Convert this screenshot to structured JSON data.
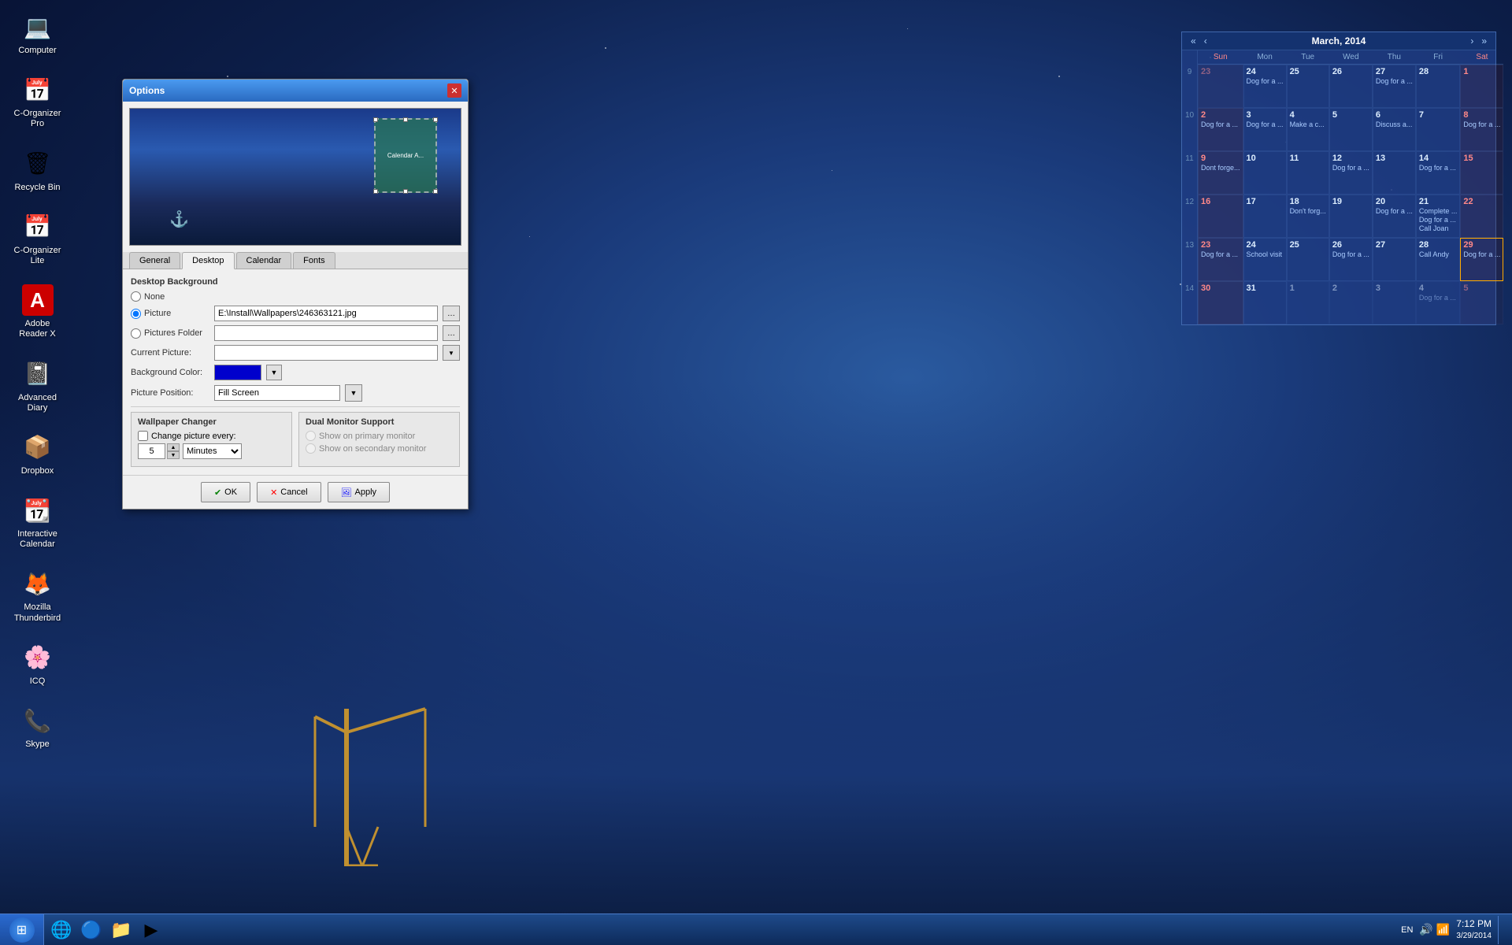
{
  "app": {
    "title": "Options"
  },
  "desktop": {
    "date": "3/29/2014",
    "time": "7:12 PM"
  },
  "taskbar": {
    "start_label": "Start",
    "clock": "7:12 PM",
    "date_label": "3/29/2014",
    "lang": "EN",
    "icons": [
      {
        "name": "ie-icon",
        "label": "Internet Explorer"
      },
      {
        "name": "chrome-icon",
        "label": "Chrome"
      },
      {
        "name": "folder-icon",
        "label": "Windows Explorer"
      },
      {
        "name": "media-icon",
        "label": "Media Player"
      }
    ]
  },
  "desktop_icons": [
    {
      "id": "computer",
      "label": "Computer",
      "icon": "💻"
    },
    {
      "id": "c-organizer-pro",
      "label": "C-Organizer Pro",
      "icon": "📅"
    },
    {
      "id": "recycle-bin",
      "label": "Recycle Bin",
      "icon": "🗑"
    },
    {
      "id": "c-organizer-lite",
      "label": "C-Organizer Lite",
      "icon": "📅"
    },
    {
      "id": "adobe-reader",
      "label": "Adobe Reader X",
      "icon": "📄"
    },
    {
      "id": "advanced-diary",
      "label": "Advanced Diary",
      "icon": "📓"
    },
    {
      "id": "dropbox",
      "label": "Dropbox",
      "icon": "📦"
    },
    {
      "id": "interactive-calendar",
      "label": "Interactive Calendar",
      "icon": "📆"
    },
    {
      "id": "mozilla",
      "label": "Mozilla Thunderbird",
      "icon": "🦊"
    },
    {
      "id": "icq",
      "label": "ICQ",
      "icon": "💬"
    },
    {
      "id": "skype",
      "label": "Skype",
      "icon": "📞"
    }
  ],
  "calendar": {
    "title": "March, 2014",
    "week_numbers": [
      "9",
      "10",
      "11",
      "12",
      "13",
      "14"
    ],
    "day_headers": [
      "Sun",
      "Mon",
      "Tue",
      "Wed",
      "Thu",
      "Fri",
      "Sat"
    ],
    "weeks": [
      {
        "week_num": "9",
        "days": [
          {
            "date": "23",
            "month": "prev",
            "events": []
          },
          {
            "date": "24",
            "month": "current",
            "events": [
              "Dog for a ..."
            ]
          },
          {
            "date": "25",
            "month": "current",
            "events": []
          },
          {
            "date": "26",
            "month": "current",
            "events": []
          },
          {
            "date": "27",
            "month": "current",
            "events": [
              "Dog for a ..."
            ]
          },
          {
            "date": "28",
            "month": "current",
            "events": []
          },
          {
            "date": "1",
            "month": "current",
            "events": [],
            "is_sunday": true
          }
        ]
      },
      {
        "week_num": "10",
        "days": [
          {
            "date": "2",
            "month": "current",
            "events": [
              "Dog for a ..."
            ],
            "is_sunday": true
          },
          {
            "date": "3",
            "month": "current",
            "events": [
              "Dog for a ..."
            ]
          },
          {
            "date": "4",
            "month": "current",
            "events": [
              "Make a c..."
            ]
          },
          {
            "date": "5",
            "month": "current",
            "events": []
          },
          {
            "date": "6",
            "month": "current",
            "events": [
              "Discuss a..."
            ]
          },
          {
            "date": "7",
            "month": "current",
            "events": []
          },
          {
            "date": "8",
            "month": "current",
            "events": [
              "Dog for a ..."
            ],
            "is_sunday": true
          }
        ]
      },
      {
        "week_num": "11",
        "days": [
          {
            "date": "9",
            "month": "current",
            "events": [
              "Dont forge..."
            ],
            "is_sunday": true
          },
          {
            "date": "10",
            "month": "current",
            "events": []
          },
          {
            "date": "11",
            "month": "current",
            "events": []
          },
          {
            "date": "12",
            "month": "current",
            "events": [
              "Dog for a ..."
            ]
          },
          {
            "date": "13",
            "month": "current",
            "events": []
          },
          {
            "date": "14",
            "month": "current",
            "events": [
              "Dog for a ..."
            ]
          },
          {
            "date": "15",
            "month": "current",
            "events": [],
            "is_sunday": true
          }
        ]
      },
      {
        "week_num": "12",
        "days": [
          {
            "date": "16",
            "month": "current",
            "events": [],
            "is_sunday": true
          },
          {
            "date": "17",
            "month": "current",
            "events": []
          },
          {
            "date": "18",
            "month": "current",
            "events": [
              "Don't forg..."
            ]
          },
          {
            "date": "19",
            "month": "current",
            "events": []
          },
          {
            "date": "20",
            "month": "current",
            "events": [
              "Dog for a ..."
            ]
          },
          {
            "date": "21",
            "month": "current",
            "events": [
              "Complete...",
              "Dog for a ...",
              "Call Joan"
            ]
          },
          {
            "date": "22",
            "month": "current",
            "events": [],
            "is_sunday": true
          }
        ]
      },
      {
        "week_num": "13",
        "days": [
          {
            "date": "23",
            "month": "current",
            "events": [
              "Dog for a ..."
            ],
            "is_sunday": true
          },
          {
            "date": "24",
            "month": "current",
            "events": [
              "School visit"
            ]
          },
          {
            "date": "25",
            "month": "current",
            "events": []
          },
          {
            "date": "26",
            "month": "current",
            "events": [
              "Dog for a ..."
            ]
          },
          {
            "date": "27",
            "month": "current",
            "events": []
          },
          {
            "date": "28",
            "month": "current",
            "events": [
              "Call Andy"
            ]
          },
          {
            "date": "29",
            "month": "current",
            "events": [
              "Dog for a ..."
            ],
            "is_today": true,
            "is_sunday": true
          }
        ]
      },
      {
        "week_num": "14",
        "days": [
          {
            "date": "30",
            "month": "current",
            "events": [],
            "is_sunday": true
          },
          {
            "date": "31",
            "month": "current",
            "events": []
          },
          {
            "date": "1",
            "month": "next",
            "events": []
          },
          {
            "date": "2",
            "month": "next",
            "events": []
          },
          {
            "date": "3",
            "month": "next",
            "events": []
          },
          {
            "date": "4",
            "month": "next",
            "events": [
              "Dog for a ..."
            ]
          },
          {
            "date": "5",
            "month": "next",
            "events": [],
            "is_sunday": true
          }
        ]
      }
    ]
  },
  "options_dialog": {
    "title": "Options",
    "preview_label": "Calendar A...",
    "tabs": [
      {
        "id": "general",
        "label": "General"
      },
      {
        "id": "desktop",
        "label": "Desktop",
        "active": true
      },
      {
        "id": "calendar",
        "label": "Calendar"
      },
      {
        "id": "fonts",
        "label": "Fonts"
      }
    ],
    "desktop_tab": {
      "section_title": "Desktop Background",
      "none_label": "None",
      "picture_label": "Picture",
      "picture_value": "E:\\Install\\Wallpapers\\246363121.jpg",
      "pictures_folder_label": "Pictures Folder",
      "current_picture_label": "Current Picture:",
      "bg_color_label": "Background Color:",
      "picture_position_label": "Picture Position:",
      "picture_position_value": "Fill Screen",
      "wallpaper_changer_title": "Wallpaper Changer",
      "change_every_label": "Change picture every:",
      "spinner_value": "5",
      "unit_value": "Minutes",
      "dual_monitor_title": "Dual Monitor Support",
      "show_primary_label": "Show on primary monitor",
      "show_secondary_label": "Show on secondary monitor"
    },
    "buttons": {
      "ok": "OK",
      "cancel": "Cancel",
      "apply": "Apply"
    }
  }
}
